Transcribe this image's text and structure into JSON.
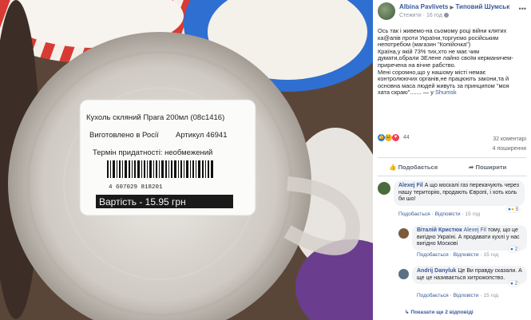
{
  "post": {
    "author": "Albina Pavlivets",
    "arrow": "▶",
    "group": "Типовий Шумськ",
    "privacy": "Стежити",
    "time": "16 год",
    "text_lines": [
      "Ось так і живемо-на сьомому році війни клятих",
      "ка@апів проти України,торгуємо російським",
      "непотребом (магазин \"Копійочка\")",
      "Країна,у якій 73% тих,хто не має чим",
      "думати,обрали ЗЕлене лайно своїм керманичем-",
      "приречена на вічне рабство.",
      "Мені соромно,що у нашому місті немає",
      "контролюючих органів,не працюють закони,та й",
      "основна маса людей живуть за принципом \"моя",
      "хата скраю\"....... — у "
    ],
    "location": "Shumsk",
    "reaction_count": "44",
    "comments_count": "32 коментарі",
    "shares_count": "4 поширення",
    "like_label": "Подобається",
    "share_label": "Поширити"
  },
  "photo": {
    "label_line1": "Кухоль скляний Прага  200мл (08с1416)",
    "label_line2a": "Виготовлено в Росії",
    "label_line2b": "Артикул 46941",
    "label_line3": "Термін придатності: необмежений",
    "barcode_digits": "4  607029  818201",
    "price": "Вартість - 15.95 грн"
  },
  "comments": [
    {
      "name": "Alexej Fil",
      "text": "А що москалі газ перекачують через нашу територію, продають Європі, і хоть коль би шо!",
      "like": "Подобається",
      "reply": "Відповісти",
      "time": "15 год",
      "reactions": "5"
    },
    {
      "name": "Віталій Кристюк",
      "mention": "Alexej Fil",
      "text": "тому, що це вигідно Україні. А продавати кухлі у нас вигідно Москові",
      "like": "Подобається",
      "reply": "Відповісти",
      "time": "15 год",
      "reactions": "2"
    },
    {
      "name": "Andrij Danyluk",
      "text": "Це Ви правду сказали. А ще це називається хитрожопство.",
      "like": "Подобається",
      "reply": "Відповісти",
      "time": "15 год",
      "reactions": "2"
    }
  ],
  "more_replies": "Показати ще 2 відповіді",
  "colors": {
    "link": "#385898",
    "muted": "#606770",
    "like_blue": "#1877f2",
    "heart_red": "#f33e58",
    "haha_yellow": "#f7b125"
  }
}
